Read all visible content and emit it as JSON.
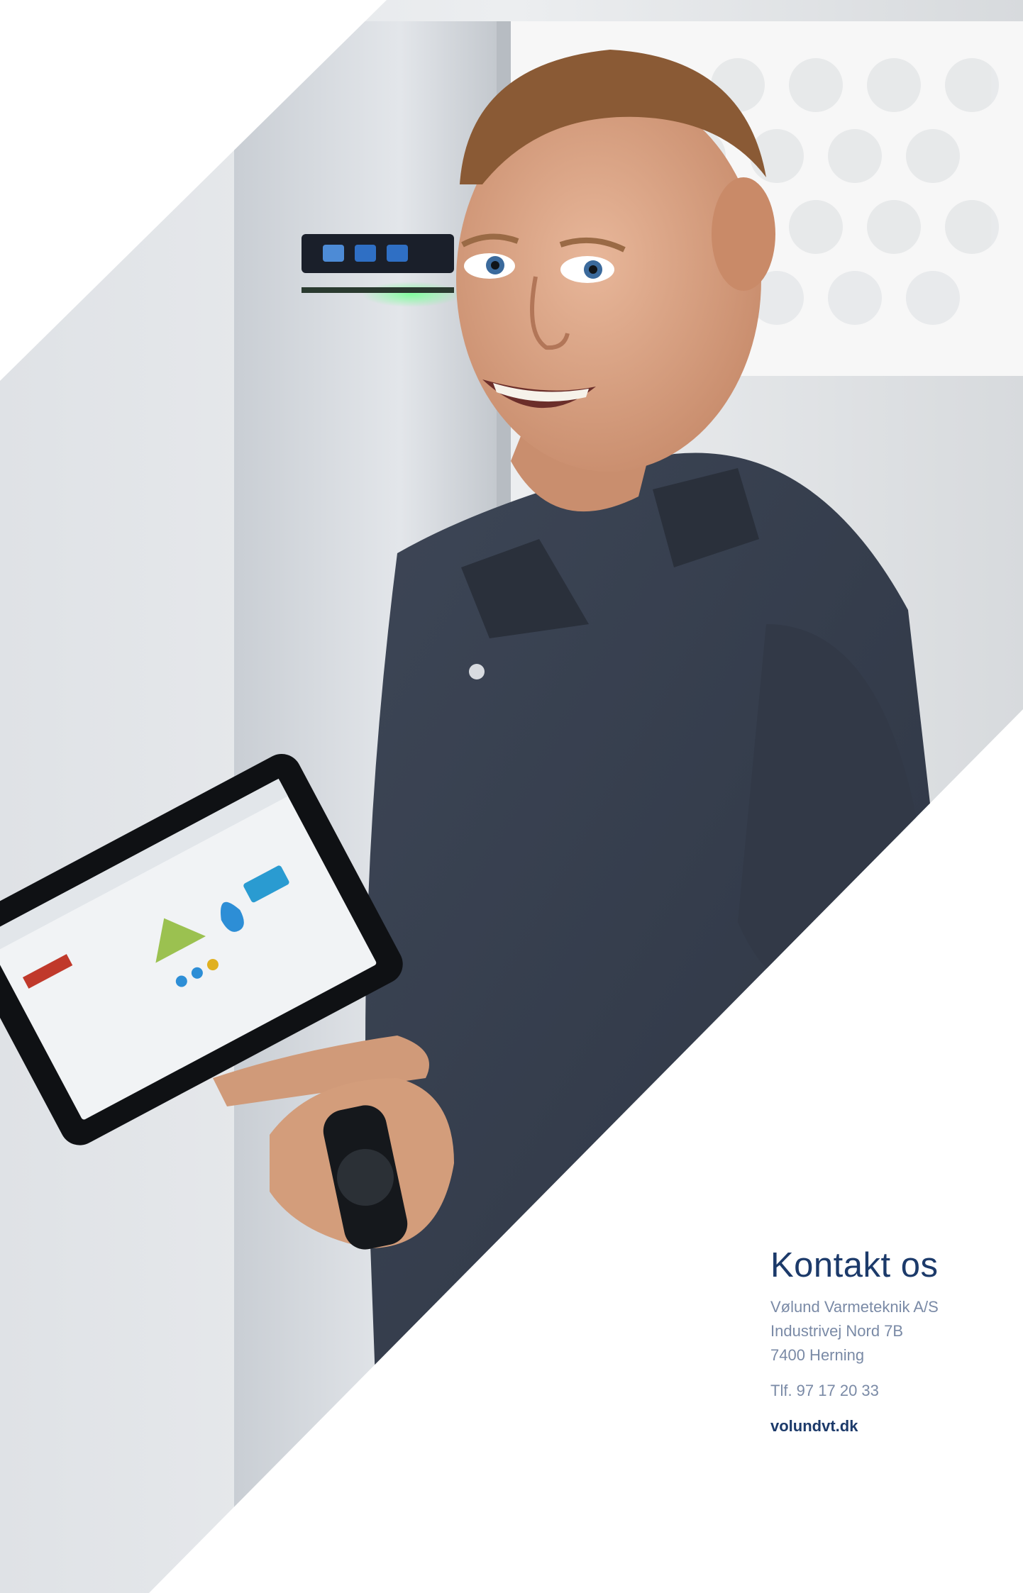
{
  "contact": {
    "heading": "Kontakt os",
    "company": "Vølund Varmeteknik A/S",
    "street": "Industrivej Nord 7B",
    "city": "7400 Herning",
    "phone": "Tlf. 97 17 20 33",
    "website": "volundvt.dk"
  },
  "colors": {
    "brand_navy": "#1c3a6a",
    "muted_text": "#7a8aa6",
    "background": "#ffffff"
  }
}
